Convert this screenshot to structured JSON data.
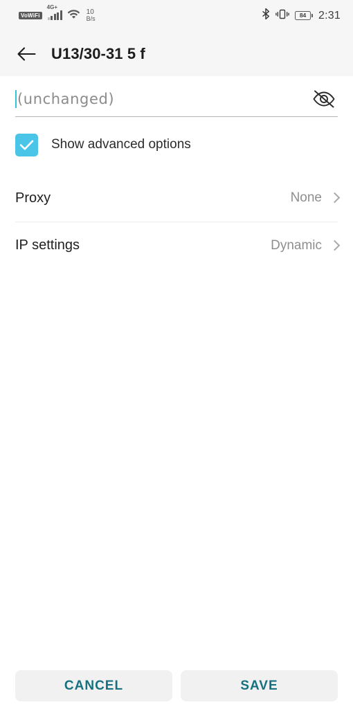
{
  "statusbar": {
    "vowifi_badge": "VoWiFi",
    "network_type": "4G+",
    "data_rate_value": "10",
    "data_rate_unit": "B/s",
    "bluetooth_icon": "bluetooth-icon",
    "vibrate_icon": "vibrate-icon",
    "battery_level": "84",
    "time": "2:31"
  },
  "appbar": {
    "back_icon": "arrow-left-icon",
    "title": "U13/30-31 5 f"
  },
  "password": {
    "placeholder": "(unchanged)",
    "value": "",
    "visibility_icon": "eye-off-icon",
    "caret_color": "#34c3dd"
  },
  "advanced": {
    "label": "Show advanced options",
    "checked": true,
    "checkbox_color": "#4ac5e8"
  },
  "settings_rows": [
    {
      "title": "Proxy",
      "value": "None",
      "chevron": "chevron-right-icon"
    },
    {
      "title": "IP settings",
      "value": "Dynamic",
      "chevron": "chevron-right-icon"
    }
  ],
  "footer": {
    "cancel_label": "CANCEL",
    "save_label": "SAVE",
    "accent_color": "#16707f"
  }
}
